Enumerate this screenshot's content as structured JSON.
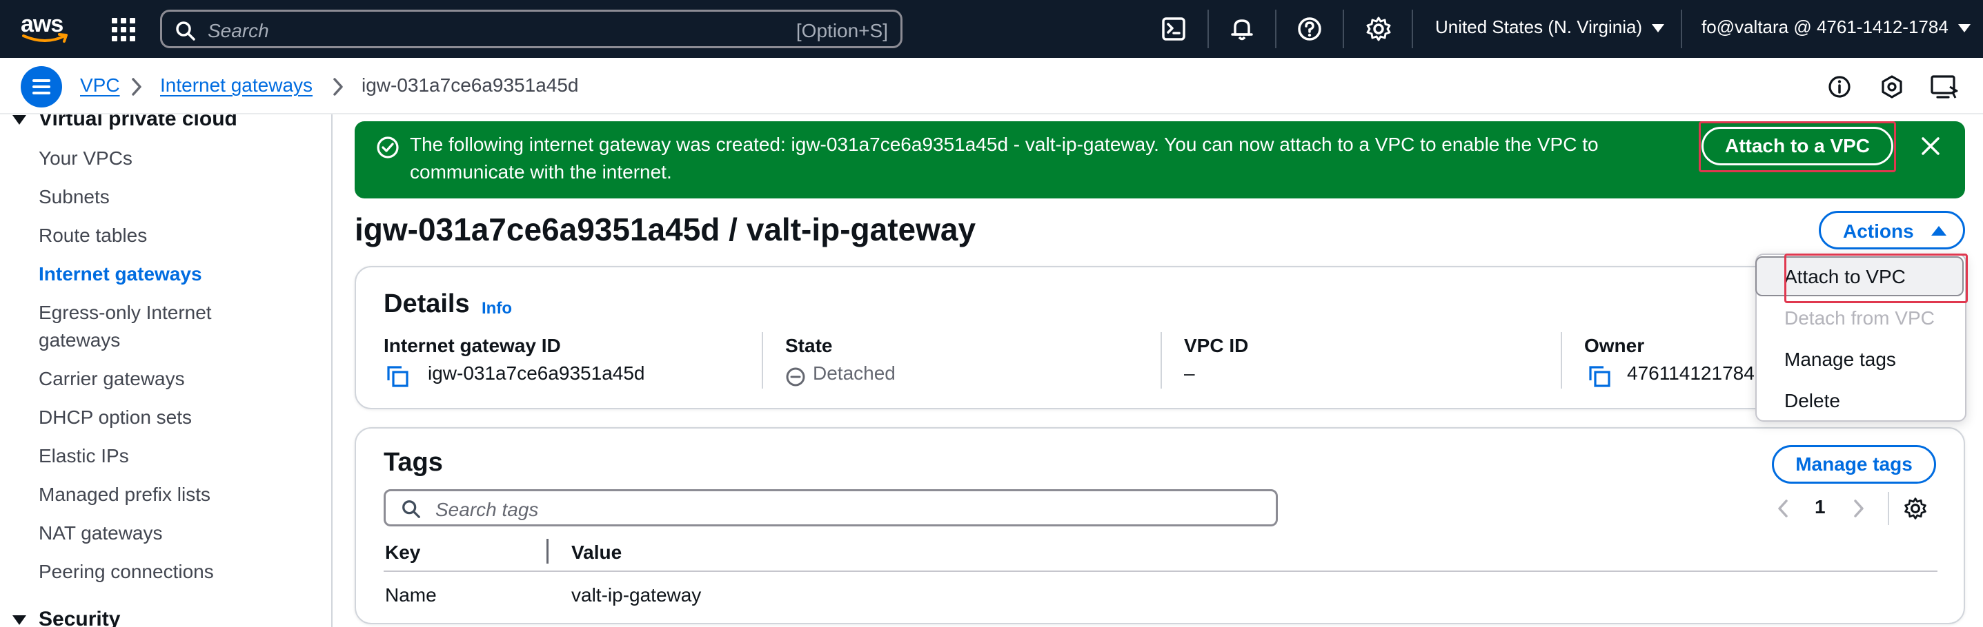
{
  "topnav": {
    "logo_text": "aws",
    "search_placeholder": "Search",
    "search_shortcut": "[Option+S]",
    "icons": [
      "cloudshell-icon",
      "bell-icon",
      "help-icon",
      "gear-icon"
    ],
    "region": "United States (N. Virginia)",
    "account": "fo@valtara @ 4761-1412-1784"
  },
  "breadcrumb": {
    "items": [
      "VPC",
      "Internet gateways"
    ],
    "current": "igw-031a7ce6a9351a45d"
  },
  "sidebar": {
    "section_top": "Virtual private cloud",
    "items": [
      {
        "label": "Your VPCs"
      },
      {
        "label": "Subnets"
      },
      {
        "label": "Route tables"
      },
      {
        "label": "Internet gateways",
        "active": true
      },
      {
        "label": "Egress-only Internet gateways"
      },
      {
        "label": "Carrier gateways"
      },
      {
        "label": "DHCP option sets"
      },
      {
        "label": "Elastic IPs"
      },
      {
        "label": "Managed prefix lists"
      },
      {
        "label": "NAT gateways"
      },
      {
        "label": "Peering connections"
      }
    ],
    "section_bottom": "Security"
  },
  "flash": {
    "line1": "The following internet gateway was created: igw-031a7ce6a9351a45d - valt-ip-gateway. You can now attach to a VPC to enable the VPC to",
    "line2": "communicate with the internet.",
    "action_label": "Attach to a VPC",
    "color": "#00802f"
  },
  "page": {
    "title": "igw-031a7ce6a9351a45d / valt-ip-gateway",
    "actions_label": "Actions"
  },
  "details": {
    "heading": "Details",
    "info": "Info",
    "columns": [
      {
        "label": "Internet gateway ID",
        "value": "igw-031a7ce6a9351a45d"
      },
      {
        "label": "State",
        "value": "Detached"
      },
      {
        "label": "VPC ID",
        "value": "–"
      },
      {
        "label": "Owner",
        "value": "476114121784"
      }
    ]
  },
  "tags": {
    "heading": "Tags",
    "manage_label": "Manage tags",
    "search_placeholder": "Search tags",
    "page": "1",
    "columns": [
      "Key",
      "Value"
    ],
    "rows": [
      {
        "key": "Name",
        "value": "valt-ip-gateway"
      }
    ]
  },
  "actions_menu": {
    "items": [
      {
        "label": "Attach to VPC",
        "enabled": true
      },
      {
        "label": "Detach from VPC",
        "enabled": false
      },
      {
        "label": "Manage tags",
        "enabled": true
      },
      {
        "label": "Delete",
        "enabled": true
      }
    ]
  },
  "colors": {
    "link": "#006ce0",
    "nav_bg": "#0f1b2a",
    "highlight": "#e0384f"
  }
}
